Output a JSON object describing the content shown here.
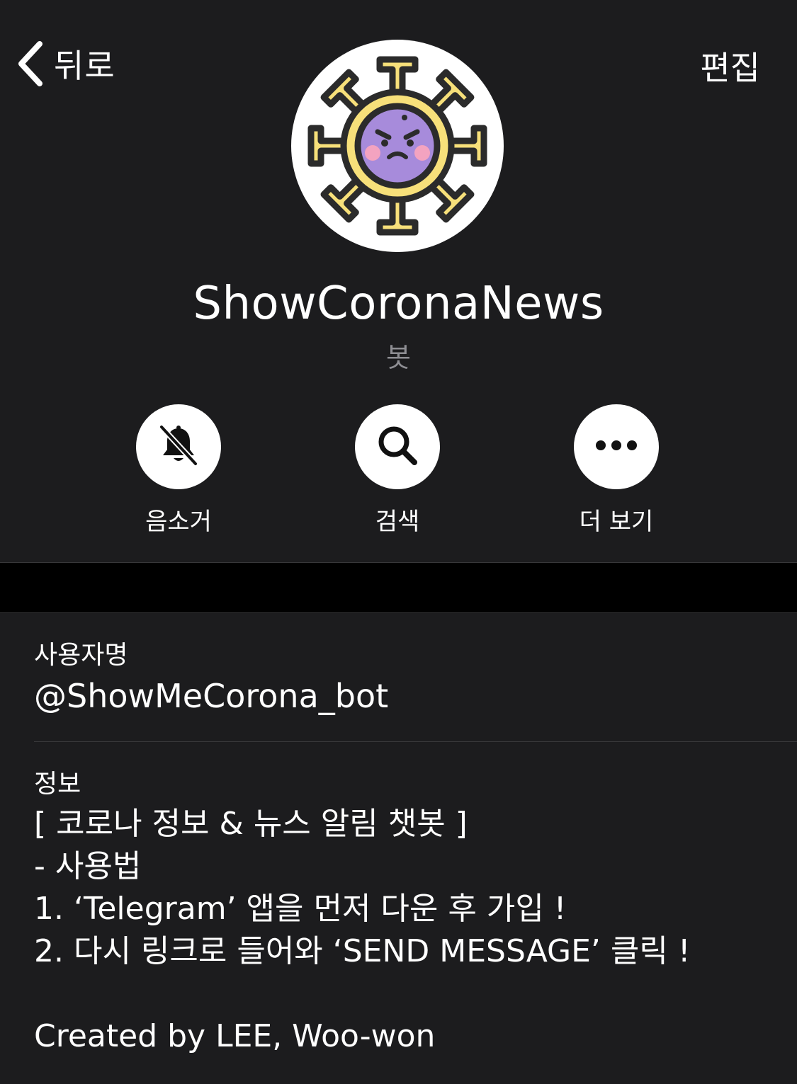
{
  "nav": {
    "back_label": "뒤로",
    "edit_label": "편집"
  },
  "profile": {
    "name": "ShowCoronaNews",
    "type_label": "봇",
    "avatar_icon": "virus-face-icon"
  },
  "actions": [
    {
      "label": "음소거",
      "icon": "bell-slash-icon"
    },
    {
      "label": "검색",
      "icon": "search-icon"
    },
    {
      "label": "더 보기",
      "icon": "more-dots-icon"
    }
  ],
  "username": {
    "label": "사용자명",
    "value": "@ShowMeCorona_bot"
  },
  "about": {
    "label": "정보",
    "lines": [
      "[ 코로나 정보 & 뉴스 알림 챗봇 ]",
      "- 사용법",
      "1. ‘Telegram’ 앱을 먼저 다운 후 가입 !",
      "2. 다시 링크로 들어와 ‘SEND MESSAGE’ 클릭 !",
      "",
      "Created by LEE, Woo-won"
    ]
  },
  "colors": {
    "background": "#1c1c1e",
    "band": "#000000",
    "secondary_text": "#8e8e93",
    "virus_body": "#f7e07a",
    "virus_face": "#a78bdb"
  }
}
